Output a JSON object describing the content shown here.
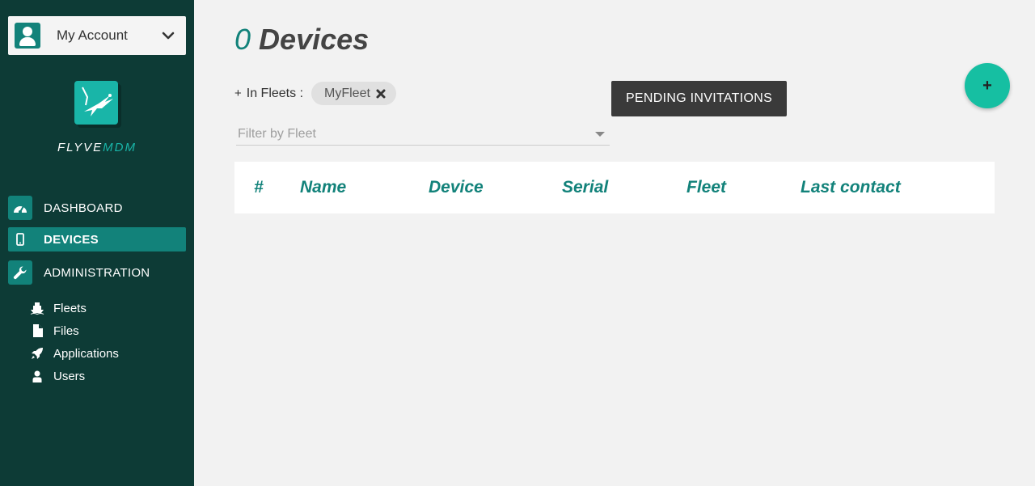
{
  "sidebar": {
    "account_label": "My Account",
    "logo_text_part1": "FLYVE",
    "logo_text_part2": "MDM",
    "nav": [
      {
        "label": "DASHBOARD",
        "icon": "dashboard-icon"
      },
      {
        "label": "DEVICES",
        "icon": "mobile-icon",
        "active": true
      },
      {
        "label": "ADMINISTRATION",
        "icon": "wrench-icon"
      }
    ],
    "sub_items": [
      {
        "label": "Fleets",
        "icon": "fleet-icon"
      },
      {
        "label": "Files",
        "icon": "file-icon"
      },
      {
        "label": "Applications",
        "icon": "rocket-icon"
      },
      {
        "label": "Users",
        "icon": "user-icon"
      }
    ]
  },
  "main": {
    "title_count": "0",
    "title_text": "Devices",
    "fleets_add": "+",
    "fleets_label": "In Fleets :",
    "fleet_chip": "MyFleet",
    "filter_placeholder": "Filter by Fleet",
    "pending_button": "PENDING INVITATIONS",
    "fab_label": "+",
    "table_headers": [
      "#",
      "Name",
      "Device",
      "Serial",
      "Fleet",
      "Last contact"
    ]
  },
  "colors": {
    "sidebar_bg": "#0d3b36",
    "accent": "#12827a",
    "fab": "#16bfa2",
    "page_bg": "#f2f2f2"
  }
}
